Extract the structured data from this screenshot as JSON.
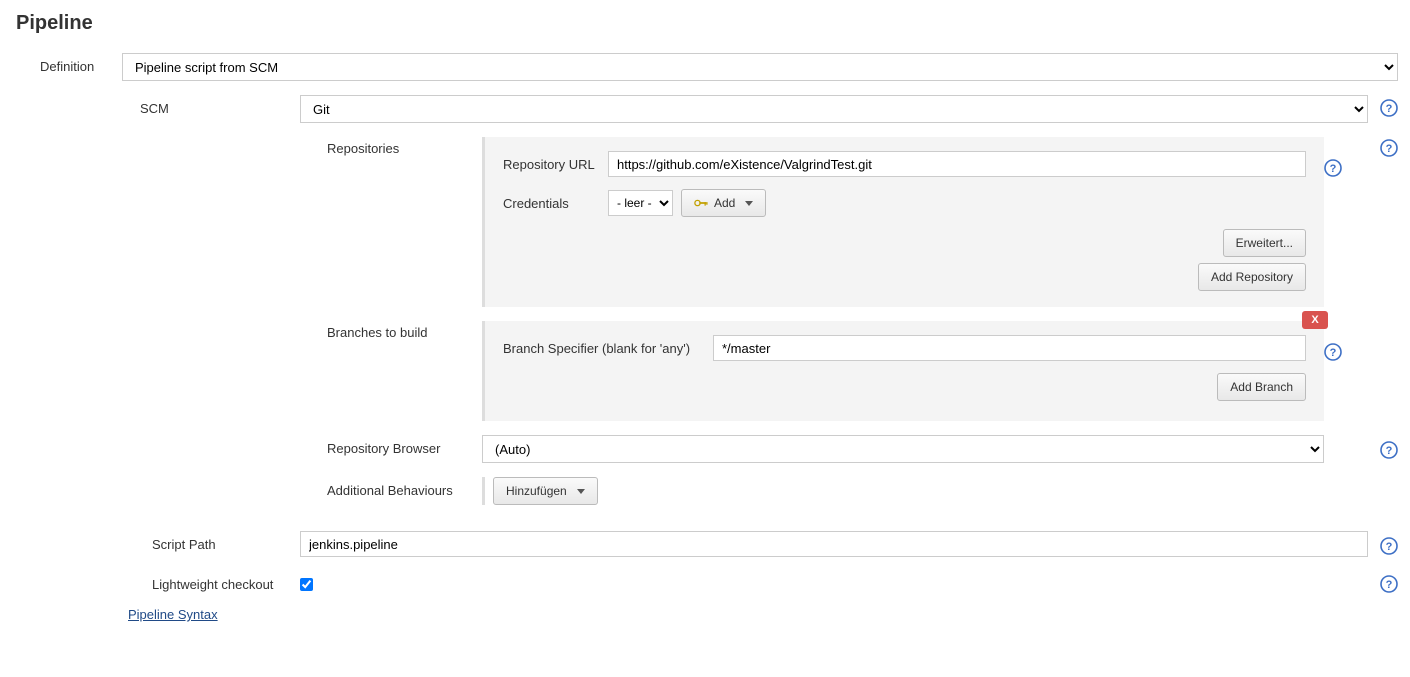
{
  "section_title": "Pipeline",
  "definition": {
    "label": "Definition",
    "selected": "Pipeline script from SCM"
  },
  "scm": {
    "label": "SCM",
    "selected": "Git"
  },
  "repositories": {
    "label": "Repositories",
    "url_label": "Repository URL",
    "url_value": "https://github.com/eXistence/ValgrindTest.git",
    "credentials_label": "Credentials",
    "credentials_selected": "- leer -",
    "add_label": "Add",
    "advanced_label": "Erweitert...",
    "add_repo_label": "Add Repository"
  },
  "branches": {
    "label": "Branches to build",
    "specifier_label": "Branch Specifier (blank for 'any')",
    "specifier_value": "*/master",
    "add_branch_label": "Add Branch",
    "delete_label": "X"
  },
  "repo_browser": {
    "label": "Repository Browser",
    "selected": "(Auto)"
  },
  "additional": {
    "label": "Additional Behaviours",
    "button_label": "Hinzufügen"
  },
  "script_path": {
    "label": "Script Path",
    "value": "jenkins.pipeline"
  },
  "lightweight": {
    "label": "Lightweight checkout",
    "checked": true
  },
  "pipeline_syntax_link": "Pipeline Syntax"
}
